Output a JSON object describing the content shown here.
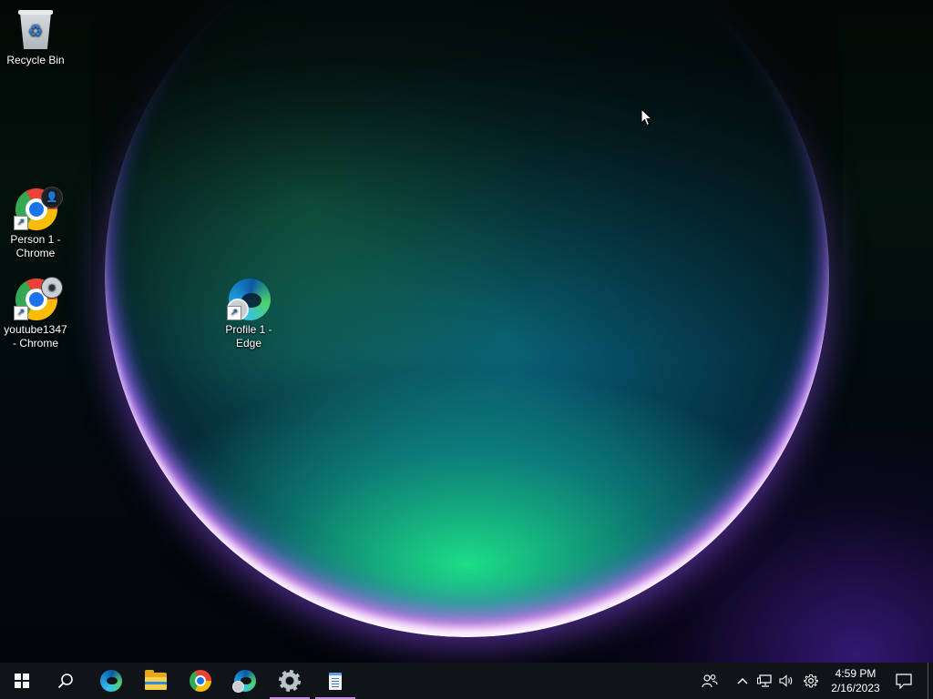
{
  "desktop": {
    "icons": [
      {
        "label": "Recycle Bin",
        "icon": "recycle-bin-icon"
      },
      {
        "label": "Person 1 - Chrome",
        "icon": "chrome-icon"
      },
      {
        "label": "youtube1347 - Chrome",
        "icon": "chrome-icon"
      },
      {
        "label": "Profile 1 - Edge",
        "icon": "edge-icon"
      }
    ]
  },
  "taskbar": {
    "start": {
      "icon": "windows-logo-icon"
    },
    "search": {
      "icon": "search-icon"
    },
    "pinned": [
      {
        "name": "Microsoft Edge",
        "icon": "edge-icon"
      },
      {
        "name": "File Explorer",
        "icon": "folder-icon"
      },
      {
        "name": "Google Chrome",
        "icon": "chrome-icon"
      },
      {
        "name": "Microsoft Edge Profile",
        "icon": "edge-profile-icon"
      },
      {
        "name": "Settings",
        "icon": "gear-icon",
        "active": true
      },
      {
        "name": "Notepad",
        "icon": "notepad-icon",
        "active": true
      }
    ],
    "tray": {
      "people": {
        "icon": "people-icon"
      },
      "chevron": {
        "icon": "chevron-up-icon",
        "glyph": "^"
      },
      "network": {
        "icon": "network-icon"
      },
      "volume": {
        "icon": "volume-icon"
      },
      "settings": {
        "icon": "gear-icon"
      },
      "notifications": {
        "icon": "notification-icon"
      }
    },
    "clock": {
      "time": "4:59 PM",
      "date": "2/16/2023"
    }
  },
  "colors": {
    "taskbar_bg": "#101418",
    "active_indicator": "#c38ae8"
  }
}
